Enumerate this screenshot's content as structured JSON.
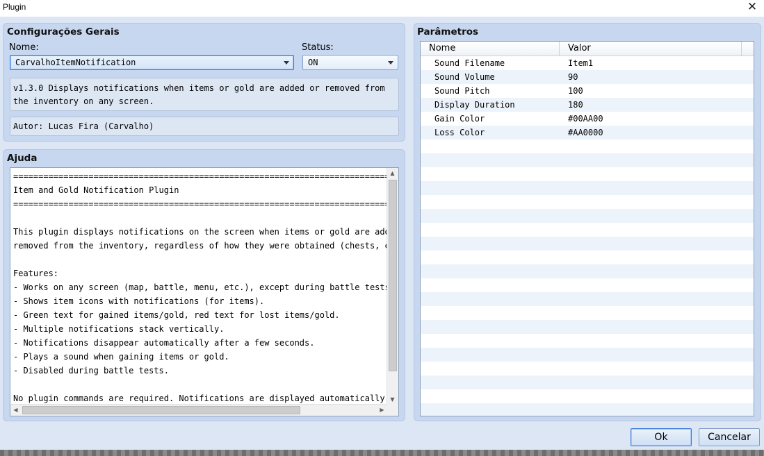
{
  "window": {
    "title": "Plugin"
  },
  "general": {
    "title": "Configurações Gerais",
    "name_label": "Nome:",
    "name_value": "CarvalhoItemNotification",
    "status_label": "Status:",
    "status_value": "ON",
    "description": "v1.3.0 Displays notifications when items or gold are added or removed from the inventory on any screen.",
    "author": "Autor: Lucas Fira (Carvalho)"
  },
  "help": {
    "title": "Ajuda",
    "lines": [
      "============================================================================",
      "Item and Gold Notification Plugin",
      "============================================================================",
      "",
      "This plugin displays notifications on the screen when items or gold are added or",
      "removed from the inventory, regardless of how they were obtained (chests, events,",
      "",
      "Features:",
      "- Works on any screen (map, battle, menu, etc.), except during battle tests.",
      "- Shows item icons with notifications (for items).",
      "- Green text for gained items/gold, red text for lost items/gold.",
      "- Multiple notifications stack vertically.",
      "- Notifications disappear automatically after a few seconds.",
      "- Plays a sound when gaining items or gold.",
      "- Disabled during battle tests.",
      "",
      "No plugin commands are required. Notifications are displayed automatically when"
    ]
  },
  "params": {
    "title": "Parâmetros",
    "col_name": "Nome",
    "col_value": "Valor",
    "rows": [
      {
        "name": "Sound Filename",
        "value": "Item1"
      },
      {
        "name": "Sound Volume",
        "value": "90"
      },
      {
        "name": "Sound Pitch",
        "value": "100"
      },
      {
        "name": "Display Duration",
        "value": "180"
      },
      {
        "name": "Gain Color",
        "value": "#00AA00"
      },
      {
        "name": "Loss Color",
        "value": "#AA0000"
      }
    ]
  },
  "buttons": {
    "ok": "Ok",
    "cancel": "Cancelar"
  }
}
